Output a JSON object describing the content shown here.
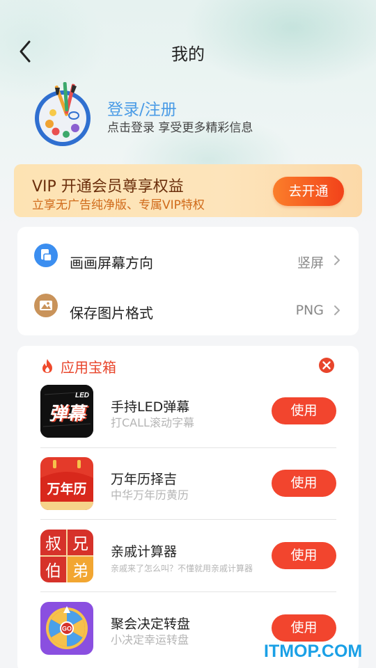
{
  "header": {
    "title": "我的"
  },
  "profile": {
    "login_label": "登录/注册",
    "subtitle": "点击登录 享受更多精彩信息"
  },
  "vip": {
    "title": "VIP 开通会员尊享权益",
    "subtitle": "立享无广告纯净版、专属VIP特权",
    "button_label": "去开通"
  },
  "settings": [
    {
      "label": "画画屏幕方向",
      "value": "竖屏",
      "icon": "screen-rotate-icon"
    },
    {
      "label": "保存图片格式",
      "value": "PNG",
      "icon": "image-icon"
    }
  ],
  "app_box": {
    "title": "应用宝箱",
    "apps": [
      {
        "name": "手持LED弹幕",
        "desc": "打CALL滚动字幕",
        "button": "使用",
        "icon_text": "弹幕",
        "icon_badge": "LED"
      },
      {
        "name": "万年历择吉",
        "desc": "中华万年历黄历",
        "button": "使用",
        "icon_text": "万年历"
      },
      {
        "name": "亲戚计算器",
        "desc": "亲戚来了怎么叫？不懂就用亲戚计算器",
        "button": "使用",
        "icon_chars": [
          "叔",
          "兄",
          "伯",
          "弟"
        ]
      },
      {
        "name": "聚会决定转盘",
        "desc": "小决定幸运转盘",
        "button": "使用",
        "icon_text": "GO"
      }
    ]
  },
  "watermark": "ITMOP.COM",
  "colors": {
    "accent_red": "#f2452e",
    "link_blue": "#4a9be6",
    "vip_brown": "#6b2f0c",
    "vip_orange": "#d06a1a"
  }
}
